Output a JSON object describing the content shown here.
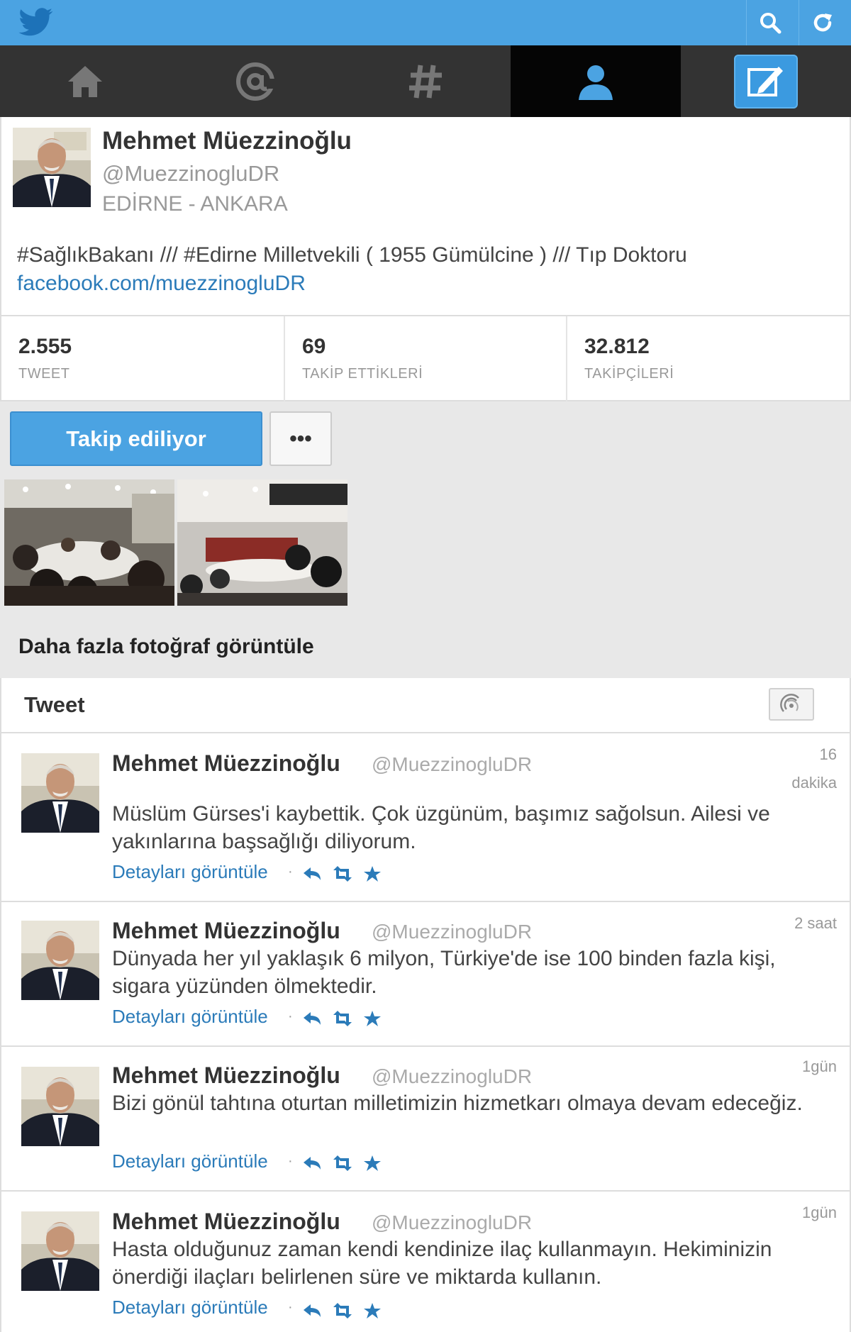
{
  "colors": {
    "brand": "#4ba3e2",
    "nav_bg": "#333333",
    "nav_active": "#050505",
    "link": "#2b7bb9"
  },
  "topbar": {
    "logo_icon": "twitter-bird-icon",
    "search_icon": "search-icon",
    "refresh_icon": "refresh-icon"
  },
  "nav": {
    "items": [
      "home-icon",
      "at-mention-icon",
      "hashtag-icon",
      "profile-icon",
      "compose-icon"
    ],
    "active": "profile-icon"
  },
  "profile": {
    "name": "Mehmet Müezzinoğlu",
    "handle": "@MuezzinogluDR",
    "location": "EDİRNE - ANKARA",
    "bio": "#SağlıkBakanı /// #Edirne Milletvekili ( 1955 Gümülcine ) /// Tıp Doktoru",
    "link": "facebook.com/muezzinogluDR"
  },
  "stats": [
    {
      "value": "2.555",
      "label": "TWEET"
    },
    {
      "value": "69",
      "label": "TAKİP ETTİKLERİ"
    },
    {
      "value": "32.812",
      "label": "TAKİPÇİLERİ"
    }
  ],
  "actions": {
    "follow_label": "Takip ediliyor",
    "more_label": "•••"
  },
  "photos": {
    "more_label": "Daha fazla fotoğraf görüntüle"
  },
  "timeline": {
    "title": "Tweet"
  },
  "tweets": [
    {
      "name": "Mehmet Müezzinoğlu",
      "handle": "@MuezzinogluDR",
      "time_line1": "16",
      "time_line2": "dakika",
      "text": "Müslüm Gürses'i kaybettik. Çok üzgünüm, başımız sağolsun. Ailesi ve yakınlarına başsağlığı diliyorum.",
      "details": "Detayları görüntüle"
    },
    {
      "name": "Mehmet Müezzinoğlu",
      "handle": "@MuezzinogluDR",
      "time_line1": "2 saat",
      "time_line2": "",
      "text": "Dünyada her yıl yaklaşık 6 milyon, Türkiye'de ise 100 binden fazla kişi, sigara yüzünden ölmektedir.",
      "details": "Detayları görüntüle"
    },
    {
      "name": "Mehmet Müezzinoğlu",
      "handle": "@MuezzinogluDR",
      "time_line1": "1gün",
      "time_line2": "",
      "text": "Bizi gönül tahtına oturtan milletimizin hizmetkarı olmaya devam edeceğiz.",
      "details": "Detayları görüntüle"
    },
    {
      "name": "Mehmet Müezzinoğlu",
      "handle": "@MuezzinogluDR",
      "time_line1": "1gün",
      "time_line2": "",
      "text": "Hasta olduğunuz zaman kendi kendinize ilaç kullanmayın. Hekiminizin önerdiği ilaçları belirlenen süre ve miktarda kullanın.",
      "details": "Detayları görüntüle"
    }
  ]
}
